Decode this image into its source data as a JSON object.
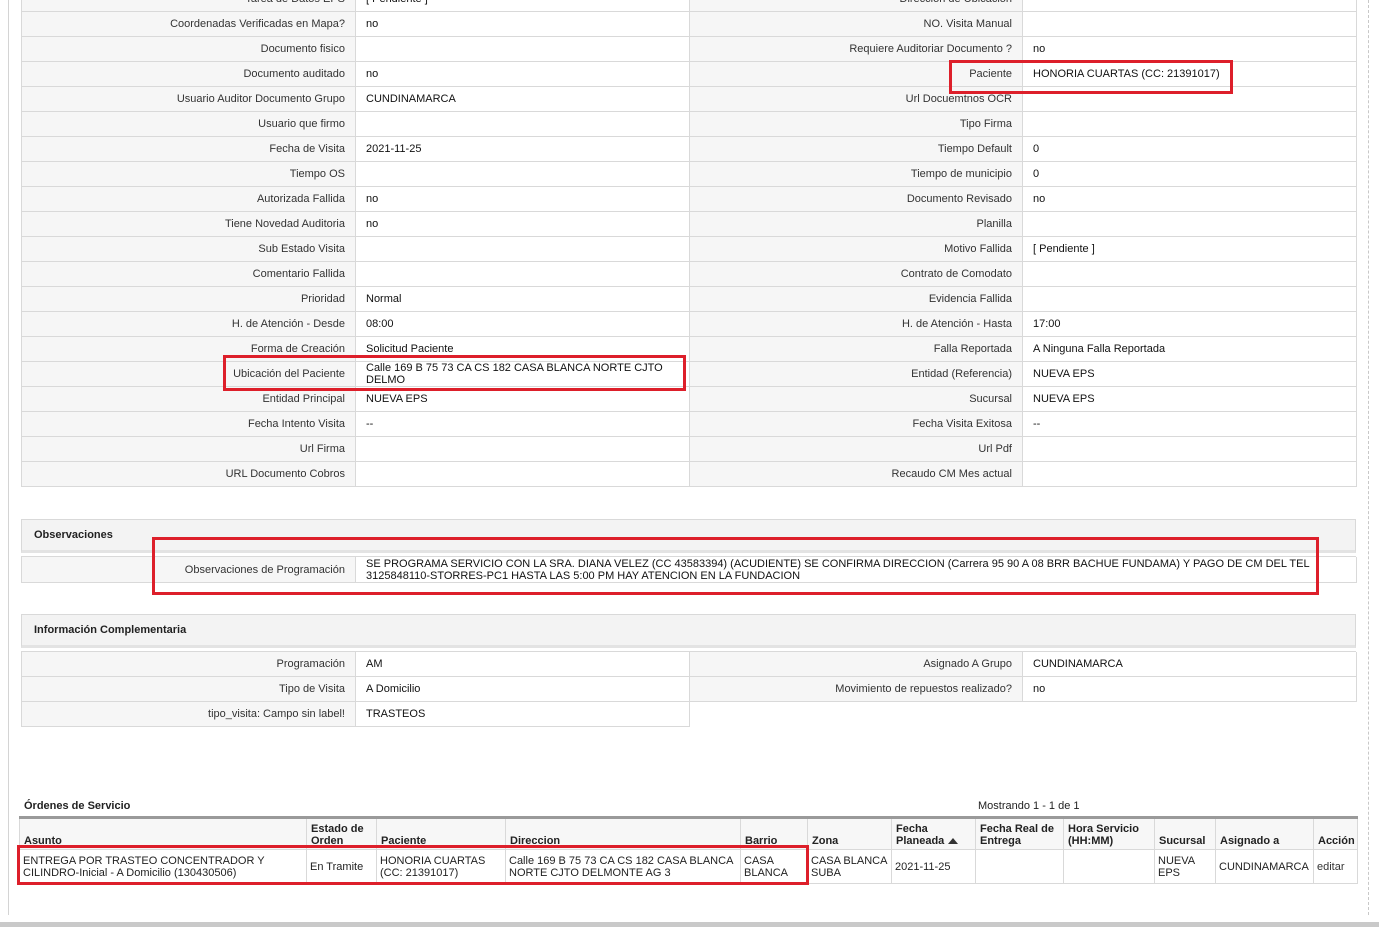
{
  "details": {
    "rows": [
      [
        "Tarea de Datos EPS",
        "[ Pendiente ]",
        "Dirección de Ubicación",
        ""
      ],
      [
        "Coordenadas Verificadas en Mapa?",
        "no",
        "NO. Visita Manual",
        ""
      ],
      [
        "Documento fisico",
        "",
        "Requiere Auditoriar Documento ?",
        "no"
      ],
      [
        "Documento auditado",
        "no",
        "Paciente",
        "HONORIA CUARTAS (CC: 21391017)"
      ],
      [
        "Usuario Auditor Documento Grupo",
        "CUNDINAMARCA",
        "Url Docuemtnos OCR",
        ""
      ],
      [
        "Usuario que firmo",
        "",
        "Tipo Firma",
        ""
      ],
      [
        "Fecha de Visita",
        "2021-11-25",
        "Tiempo Default",
        "0"
      ],
      [
        "Tiempo OS",
        "",
        "Tiempo de municipio",
        "0"
      ],
      [
        "Autorizada Fallida",
        "no",
        "Documento Revisado",
        "no"
      ],
      [
        "Tiene Novedad Auditoria",
        "no",
        "Planilla",
        ""
      ],
      [
        "Sub Estado Visita",
        "",
        "Motivo Fallida",
        "[ Pendiente ]"
      ],
      [
        "Comentario Fallida",
        "",
        "Contrato de Comodato",
        ""
      ],
      [
        "Prioridad",
        "Normal",
        "Evidencia Fallida",
        ""
      ],
      [
        "H. de Atención - Desde",
        "08:00",
        "H. de Atención - Hasta",
        "17:00"
      ],
      [
        "Forma de Creación",
        "Solicitud Paciente",
        "Falla Reportada",
        "A Ninguna Falla Reportada"
      ],
      [
        "Ubicación del Paciente",
        "Calle 169 B 75 73 CA CS 182 CASA BLANCA NORTE CJTO DELMO",
        "Entidad (Referencia)",
        "NUEVA EPS"
      ],
      [
        "Entidad Principal",
        "NUEVA EPS",
        "Sucursal",
        "NUEVA EPS"
      ],
      [
        "Fecha Intento Visita",
        "--",
        "Fecha Visita Exitosa",
        "--"
      ],
      [
        "Url Firma",
        "",
        "Url Pdf",
        ""
      ],
      [
        "URL Documento Cobros",
        "",
        "Recaudo CM Mes actual",
        ""
      ]
    ]
  },
  "observaciones": {
    "title": "Observaciones",
    "label": "Observaciones de Programación",
    "value": "  SE PROGRAMA SERVICIO CON LA SRA. DIANA VELEZ (CC 43583394) (ACUDIENTE) SE CONFIRMA DIRECCION (Carrera 95 90 A 08 BRR BACHUE FUNDAMA) Y PAGO DE CM DEL TEL 3125848110-STORRES-PC1 HASTA LAS 5:00 PM HAY ATENCION EN LA FUNDACION"
  },
  "info": {
    "title": "Información Complementaria",
    "rows": [
      [
        "Programación",
        "AM",
        "Asignado A Grupo",
        "CUNDINAMARCA"
      ],
      [
        "Tipo de Visita",
        "A Domicilio",
        "Movimiento de repuestos realizado?",
        "no"
      ],
      [
        "tipo_visita: Campo sin label!",
        "TRASTEOS"
      ]
    ]
  },
  "orders": {
    "title": "Órdenes de Servicio",
    "count": "Mostrando 1 - 1 de 1",
    "headers": [
      "Asunto",
      "Estado de Orden",
      "Paciente",
      "Direccion",
      "Barrio",
      "Zona",
      "Fecha Planeada",
      "Fecha Real de Entrega",
      "Hora Servicio (HH:MM)",
      "Sucursal",
      "Asignado a",
      "Acción"
    ],
    "rows": [
      [
        "ENTREGA POR TRASTEO CONCENTRADOR Y CILINDRO-Inicial - A Domicilio (130430506)",
        "En Tramite",
        "HONORIA CUARTAS (CC: 21391017)",
        "Calle 169 B 75 73 CA CS 182 CASA BLANCA NORTE CJTO DELMONTE AG 3",
        "CASA BLANCA",
        "CASA BLANCA SUBA",
        "2021-11-25",
        "",
        "",
        "NUEVA EPS",
        "CUNDINAMARCA",
        "editar"
      ]
    ]
  },
  "colors": {
    "highlight": "#dd1f2a"
  }
}
